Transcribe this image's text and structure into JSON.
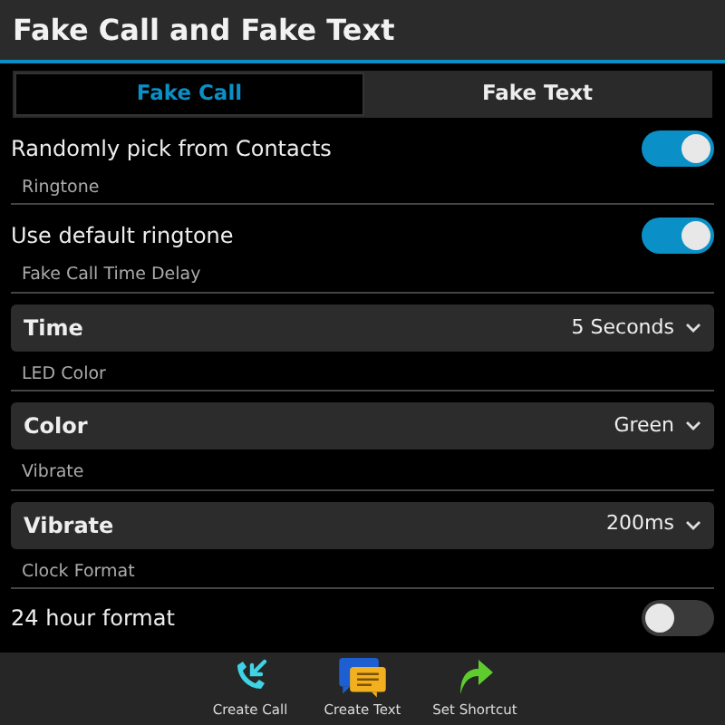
{
  "title_bar": {
    "title": "Fake Call and Fake Text"
  },
  "tabs": [
    {
      "label": "Fake Call",
      "selected": true
    },
    {
      "label": "Fake Text",
      "selected": false
    }
  ],
  "settings": [
    {
      "kind": "toggle",
      "label": "Randomly pick from Contacts",
      "on": true
    },
    {
      "kind": "header",
      "label": "Ringtone"
    },
    {
      "kind": "toggle",
      "label": "Use default ringtone",
      "on": true
    },
    {
      "kind": "header",
      "label": "Fake Call Time Delay"
    },
    {
      "kind": "dropdown",
      "label": "Time",
      "value": "5 Seconds"
    },
    {
      "kind": "header",
      "label": "LED Color"
    },
    {
      "kind": "dropdown",
      "label": "Color",
      "value": "Green"
    },
    {
      "kind": "header",
      "label": "Vibrate"
    },
    {
      "kind": "dropdown",
      "label": "Vibrate",
      "value": "200ms"
    },
    {
      "kind": "header",
      "label": "Clock Format"
    },
    {
      "kind": "toggle",
      "label": "24 hour format",
      "on": false
    }
  ],
  "action_bar": [
    {
      "kind": "call",
      "label": "Create Call"
    },
    {
      "kind": "message",
      "label": "Create Text"
    },
    {
      "kind": "shortcut",
      "label": "Set Shortcut"
    }
  ]
}
